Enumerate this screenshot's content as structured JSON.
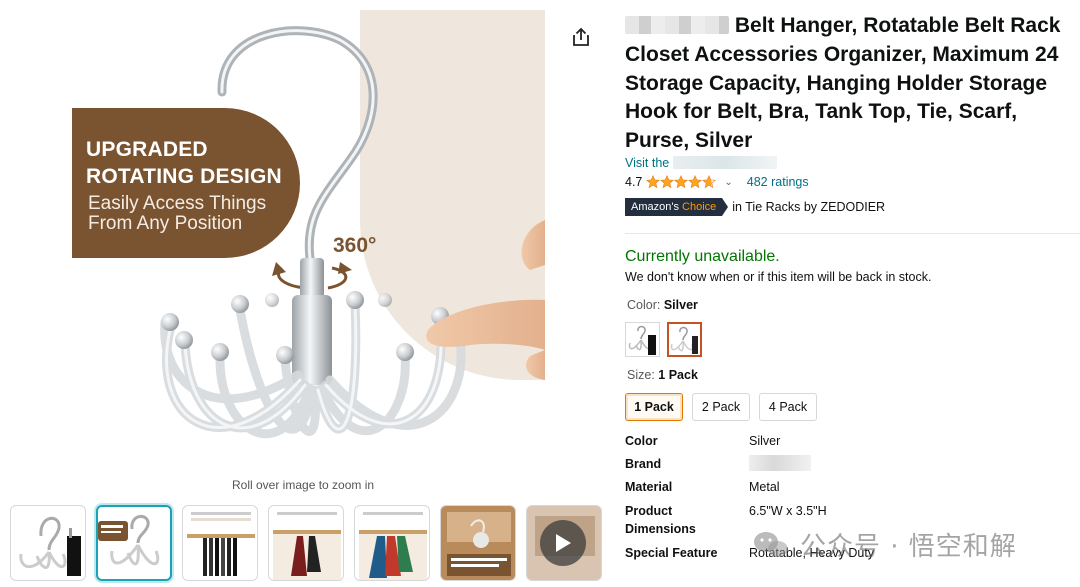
{
  "product": {
    "title_suffix": "Belt Hanger, Rotatable Belt Rack Closet Accessories Organizer, Maximum 24 Storage Capacity, Hanging Holder Storage Hook for Belt, Bra, Tank Top, Tie, Scarf, Purse, Silver",
    "visit_prefix": "Visit the",
    "rating_value": "4.7",
    "rating_stars": 4.7,
    "ratings_count": "482 ratings",
    "choice_prefix": "Amazon's",
    "choice_highlight": "Choice",
    "choice_context": "in Tie Racks by ZEDODIER"
  },
  "availability": {
    "status": "Currently unavailable.",
    "note": "We don't know when or if this item will be back in stock."
  },
  "color": {
    "label": "Color:",
    "selected": "Silver"
  },
  "size": {
    "label": "Size:",
    "selected": "1 Pack",
    "options": [
      "1 Pack",
      "2 Pack",
      "4 Pack"
    ]
  },
  "specs": [
    {
      "key": "Color",
      "value": "Silver"
    },
    {
      "key": "Brand",
      "value": ""
    },
    {
      "key": "Material",
      "value": "Metal"
    },
    {
      "key": "Product Dimensions",
      "value": "6.5\"W x 3.5\"H"
    },
    {
      "key": "Special Feature",
      "value": "Rotatable, Heavy Duty"
    }
  ],
  "image": {
    "badge_title": "UPGRADED ROTATING DESIGN",
    "badge_subtitle": "Easily Access Things From Any Position",
    "degree_label": "360°",
    "zoom_caption": "Roll over image to zoom in"
  },
  "watermark": {
    "text": "公众号 · 悟空和解"
  },
  "colors": {
    "brown": "#7a5431",
    "link": "#007185",
    "available_green": "#007600",
    "star": "#ffa41c",
    "selected_orange": "#e77600"
  }
}
